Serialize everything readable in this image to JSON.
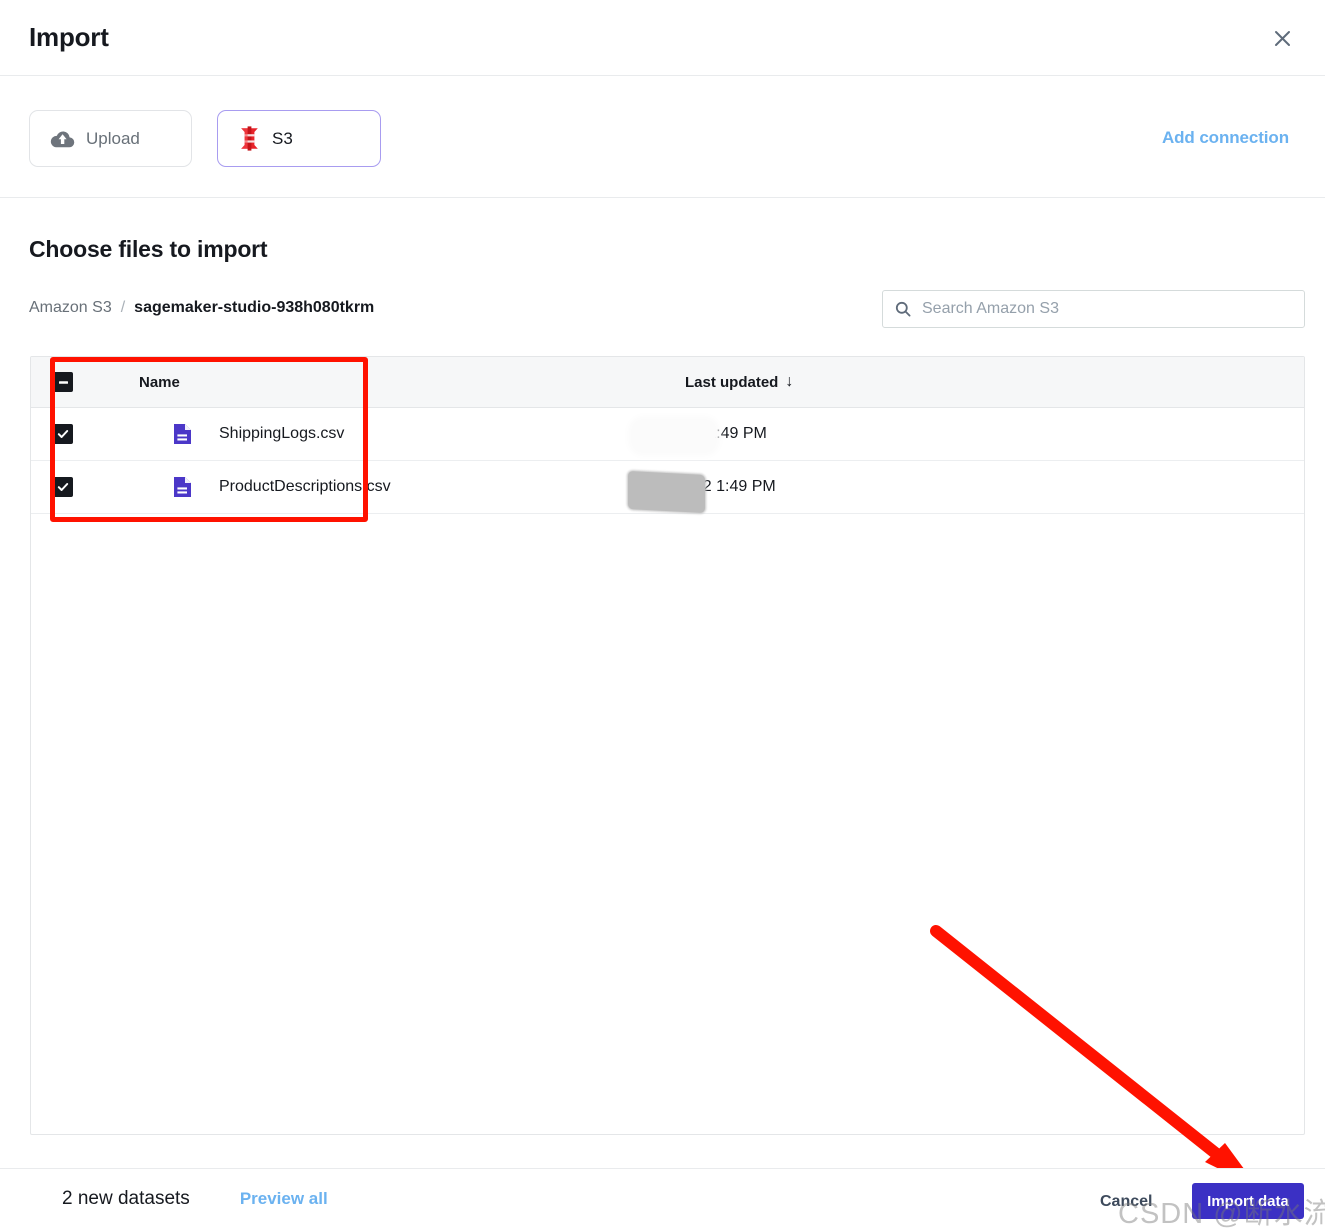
{
  "window": {
    "title": "Import",
    "close_icon": "close-icon"
  },
  "sources": {
    "items": [
      {
        "label": "Upload",
        "icon": "cloud-upload-icon",
        "selected": false
      },
      {
        "label": "S3",
        "icon": "s3-bucket-icon",
        "selected": true
      }
    ],
    "add_connection_label": "Add connection"
  },
  "main": {
    "section_title": "Choose files to import",
    "breadcrumb": {
      "root": "Amazon S3",
      "separator": "/",
      "current": "sagemaker-studio-938h080tkrm"
    },
    "search": {
      "placeholder": "Search Amazon S3",
      "value": "",
      "icon": "search-icon"
    },
    "table": {
      "columns": [
        {
          "key": "name",
          "label": "Name"
        },
        {
          "key": "last_updated",
          "label": "Last updated",
          "sort_icon": "↓",
          "sorted": true
        }
      ],
      "header_checkbox_state": "indeterminate",
      "rows": [
        {
          "selected": true,
          "icon": "csv-file-icon",
          "name": "ShippingLogs.csv",
          "last_updated": "22 1:49 PM",
          "last_updated_redacted": true
        },
        {
          "selected": true,
          "icon": "csv-file-icon",
          "name": "ProductDescriptions.csv",
          "last_updated": "022 1:49 PM",
          "last_updated_redacted": true
        }
      ]
    }
  },
  "footer": {
    "dataset_count_label": "2 new datasets",
    "preview_all_label": "Preview all",
    "cancel_label": "Cancel",
    "import_label": "Import data"
  },
  "annotations": {
    "watermark": "CSDN @断水流大撇兄",
    "highlight_color": "#ff1200",
    "arrow_color": "#ff1200"
  },
  "colors": {
    "accent_link": "#6bb2f0",
    "primary_button": "#3b30c4",
    "s3_icon": "#e8232a",
    "file_icon": "#4b37c8",
    "checkbox": "#16191f"
  }
}
